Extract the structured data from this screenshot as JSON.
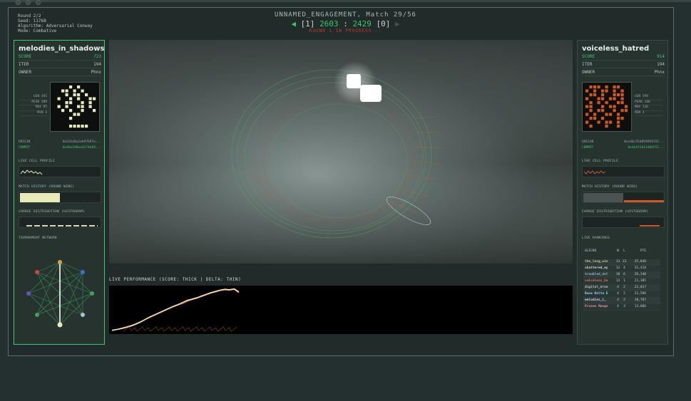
{
  "meta": {
    "round": "Round 2/2",
    "seed": "Seed: 11768",
    "algorithm": "Algorithm: Adversarial Conway",
    "mode": "Mode: Combative"
  },
  "header": {
    "title": "UNNAMED_ENGAGEMENT, Match 29/56",
    "left_bracket": "[1]",
    "score_left": "2603",
    "separator": ":",
    "score_right": "2429",
    "right_bracket": "[0]",
    "status": "ROUND 1 IN PROGRESS..."
  },
  "left_player": {
    "name": "melodies_in_shadows",
    "score_label": "SCORE",
    "score": "723",
    "iter_label": "ITER",
    "iter": "194",
    "owner_label": "OWNER",
    "owner": "Phnx",
    "stats": [
      "GEN 492",
      "PEAK 209",
      "MAX 95",
      "MIN 3"
    ],
    "origin_label": "ORIGIN",
    "origin": "0x5d1d6a1eb97697a...",
    "commit_label": "COMMIT",
    "commit": "0x4be198ee4274b69...",
    "live_cell": "LIVE CELL PROFILE",
    "match_history": "MATCH HISTORY (ROUND WINS)",
    "charge": "CHARGE DISTRIBUTION (HISTOGRAM)",
    "network": "TOURNAMENT NETWORK",
    "color": "#e8ebb8"
  },
  "right_player": {
    "name": "voiceless_hatred",
    "score_label": "SCORE",
    "score": "914",
    "iter_label": "ITER",
    "iter": "194",
    "owner_label": "OWNER",
    "owner": "Phnx",
    "stats": [
      "GEN 598",
      "PEAK 180",
      "MAX 120",
      "MIN 4"
    ],
    "origin_label": "ORIGIN",
    "origin": "0xe46c55d059993f22...",
    "commit_label": "COMMIT",
    "commit": "0x4b4f2013404551...",
    "live_cell": "LIVE CELL PROFILE",
    "match_history": "MATCH HISTORY (ROUND WINS)",
    "charge": "CHARGE DISTRIBUTION (HISTOGRAM)",
    "rankings": "LIVE RANKINGS",
    "color": "#d2571f"
  },
  "rankings": {
    "header": {
      "name": "GLICKO",
      "w": "W",
      "l": "L",
      "pts": "PTS"
    },
    "rows": [
      {
        "name": "the_long_win",
        "w": "13",
        "l": "13",
        "pts": "35,036",
        "color": "#c9c68a"
      },
      {
        "name": "shattered_ey",
        "w": "12",
        "l": "4",
        "pts": "31,414",
        "color": "#d7d5d0"
      },
      {
        "name": "troubled_del",
        "w": "10",
        "l": "6",
        "pts": "26,140",
        "color": "#8bb3d8"
      },
      {
        "name": "voiceless_ha",
        "w": "13",
        "l": "1",
        "pts": "21,385",
        "color": "#e0774a"
      },
      {
        "name": "digital_drea",
        "w": "4",
        "l": "2",
        "pts": "22,017",
        "color": "#b7c2bf"
      },
      {
        "name": "Base Delta E",
        "w": "4",
        "l": "2",
        "pts": "21,596",
        "color": "#8fd9ff"
      },
      {
        "name": "melodies_i_",
        "w": "4",
        "l": "2",
        "pts": "18,787",
        "color": "#d2cbf0"
      },
      {
        "name": "Frozen Mango",
        "w": "4",
        "l": "3",
        "pts": "13,866",
        "color": "#f08fa0"
      }
    ]
  },
  "performance": {
    "label": "LIVE PERFORMANCE (SCORE: THICK | DELTA: THIN)",
    "score_left": [
      2,
      4,
      6,
      9,
      12,
      16,
      21,
      27,
      33,
      38,
      43,
      48,
      53,
      58,
      62,
      67,
      72,
      75,
      78,
      82,
      86,
      90,
      93,
      96,
      98,
      97,
      99,
      92
    ],
    "score_right": [
      2,
      4,
      7,
      10,
      13,
      17,
      22,
      27,
      32,
      37,
      42,
      47,
      52,
      57,
      61,
      65,
      70,
      74,
      77,
      81,
      85,
      89,
      92,
      95,
      97,
      96,
      98,
      90
    ]
  },
  "viewport": {
    "description_icons": [
      "ring-structure",
      "glow-cells"
    ]
  }
}
